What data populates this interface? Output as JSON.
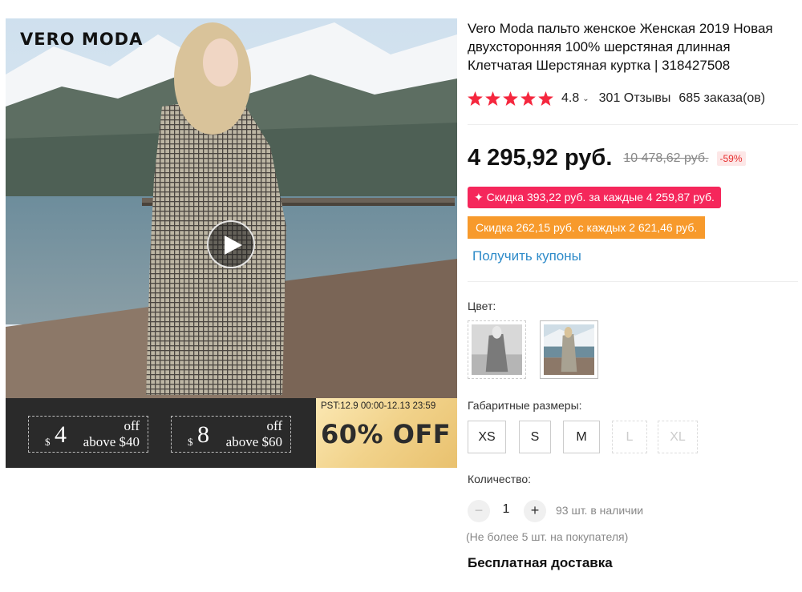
{
  "gallery": {
    "brand_logo": "VERO MODA",
    "video_play_icon": "play-icon",
    "promo": {
      "coupons": [
        {
          "currency": "$",
          "amount": "4",
          "off": "off",
          "above": "above $40"
        },
        {
          "currency": "$",
          "amount": "8",
          "off": "off",
          "above": "above $60"
        }
      ],
      "sale_dates": "PST:12.9 00:00-12.13 23:59",
      "sale_title": "60% OFF"
    }
  },
  "product": {
    "title": "Vero Moda пальто женское Женская 2019 Новая двухсторонняя 100% шерстяная длинная Клетчатая Шерстяная куртка | 318427508",
    "rating": {
      "stars": 5,
      "star_color": "#f5273e",
      "value": "4.8",
      "reviews": "301 Отзывы",
      "orders": "685 заказа(ов)"
    },
    "price": {
      "current": "4 295,92 руб.",
      "old": "10 478,62 руб.",
      "discount": "-59%"
    },
    "store_discount": "✦ Скидка 393,22 руб. за каждые 4 259,87 руб.",
    "select_discount": "Скидка 262,15 руб. с каждых 2 621,46 руб.",
    "coupons_link": "Получить купоны",
    "color_label": "Цвет:",
    "colors": [
      "black-white",
      "gray-check"
    ],
    "size_label": "Габаритные размеры:",
    "sizes": [
      {
        "label": "XS",
        "available": true
      },
      {
        "label": "S",
        "available": true
      },
      {
        "label": "M",
        "available": true
      },
      {
        "label": "L",
        "available": false
      },
      {
        "label": "XL",
        "available": false
      }
    ],
    "quantity_label": "Количество:",
    "quantity": "1",
    "minus": "−",
    "plus": "+",
    "stock": "93 шт. в наличии",
    "limit": "(Не более 5 шт. на покупателя)",
    "shipping": "Бесплатная доставка"
  }
}
